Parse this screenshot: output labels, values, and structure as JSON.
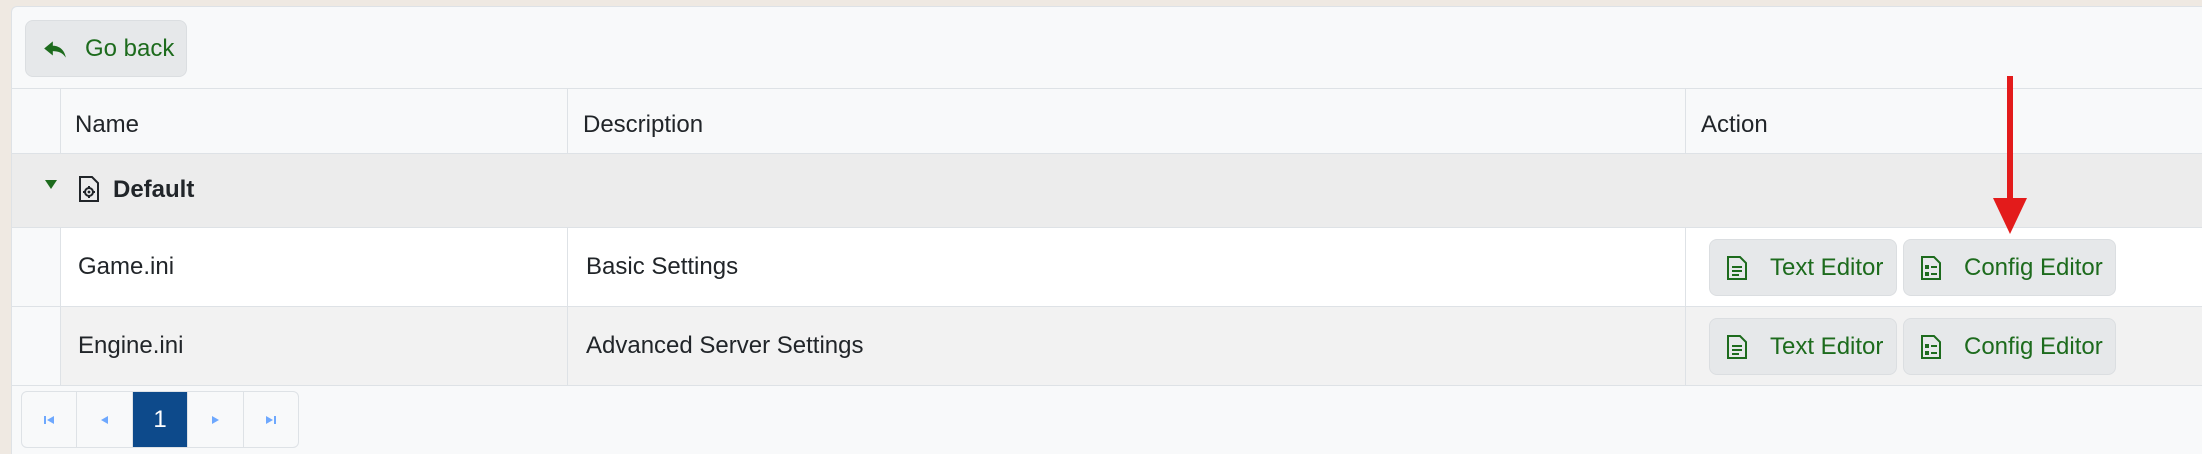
{
  "toolbar": {
    "back_label": "Go back"
  },
  "table": {
    "columns": [
      "Name",
      "Description",
      "Action"
    ],
    "group": {
      "label": "Default"
    },
    "rows": [
      {
        "name": "Game.ini",
        "description": "Basic Settings",
        "text_editor": "Text Editor",
        "config_editor": "Config Editor"
      },
      {
        "name": "Engine.ini",
        "description": "Advanced Server Settings",
        "text_editor": "Text Editor",
        "config_editor": "Config Editor"
      }
    ]
  },
  "pagination": {
    "current_page": "1"
  },
  "colors": {
    "accent_green": "#1d6b1d",
    "active_page": "#0d4a8b",
    "annotation_arrow": "#e31b1b"
  }
}
